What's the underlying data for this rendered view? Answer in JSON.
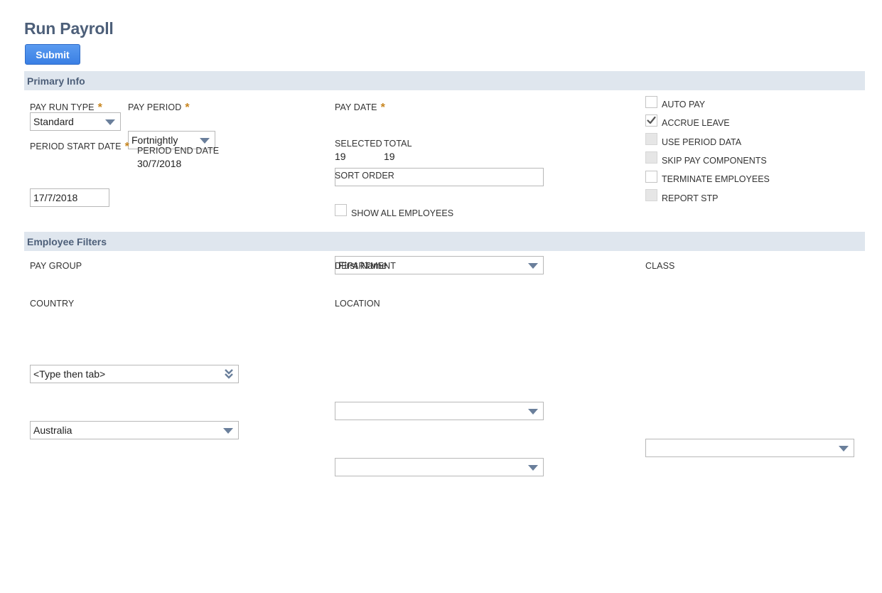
{
  "page": {
    "title": "Run Payroll"
  },
  "toolbar": {
    "submit_label": "Submit"
  },
  "primary_info": {
    "header": "Primary Info",
    "pay_run_type": {
      "label": "PAY RUN TYPE",
      "required": "*",
      "value": "Standard"
    },
    "pay_period": {
      "label": "PAY PERIOD",
      "required": "*",
      "value": "Fortnightly"
    },
    "period_start_date": {
      "label": "PERIOD START DATE",
      "required": "*",
      "value": "17/7/2018"
    },
    "period_end_date": {
      "label": "PERIOD END DATE",
      "value": "30/7/2018"
    },
    "pay_date": {
      "label": "PAY DATE",
      "required": "*",
      "value": ""
    },
    "selected": {
      "label": "SELECTED",
      "value": "19"
    },
    "total": {
      "label": "TOTAL",
      "value": "19"
    },
    "sort_order": {
      "label": "SORT ORDER",
      "value": "First Name"
    },
    "show_all_employees": {
      "label": "SHOW ALL EMPLOYEES",
      "checked": false
    },
    "options": [
      {
        "label": "AUTO PAY",
        "checked": false,
        "disabled": false
      },
      {
        "label": "ACCRUE LEAVE",
        "checked": true,
        "disabled": false
      },
      {
        "label": "USE PERIOD DATA",
        "checked": false,
        "disabled": true
      },
      {
        "label": "SKIP PAY COMPONENTS",
        "checked": false,
        "disabled": true
      },
      {
        "label": "TERMINATE EMPLOYEES",
        "checked": false,
        "disabled": false
      },
      {
        "label": "REPORT STP",
        "checked": false,
        "disabled": true
      }
    ]
  },
  "employee_filters": {
    "header": "Employee Filters",
    "pay_group": {
      "label": "PAY GROUP",
      "value": "<Type then tab>"
    },
    "country": {
      "label": "COUNTRY",
      "value": "Australia"
    },
    "department": {
      "label": "DEPARTMENT",
      "value": ""
    },
    "location": {
      "label": "LOCATION",
      "value": ""
    },
    "class": {
      "label": "CLASS",
      "value": ""
    }
  },
  "colors": {
    "accent": "#3a7fe4",
    "section_bg": "#dfe6ee",
    "heading": "#4d5f79",
    "required": "#c8851e"
  }
}
